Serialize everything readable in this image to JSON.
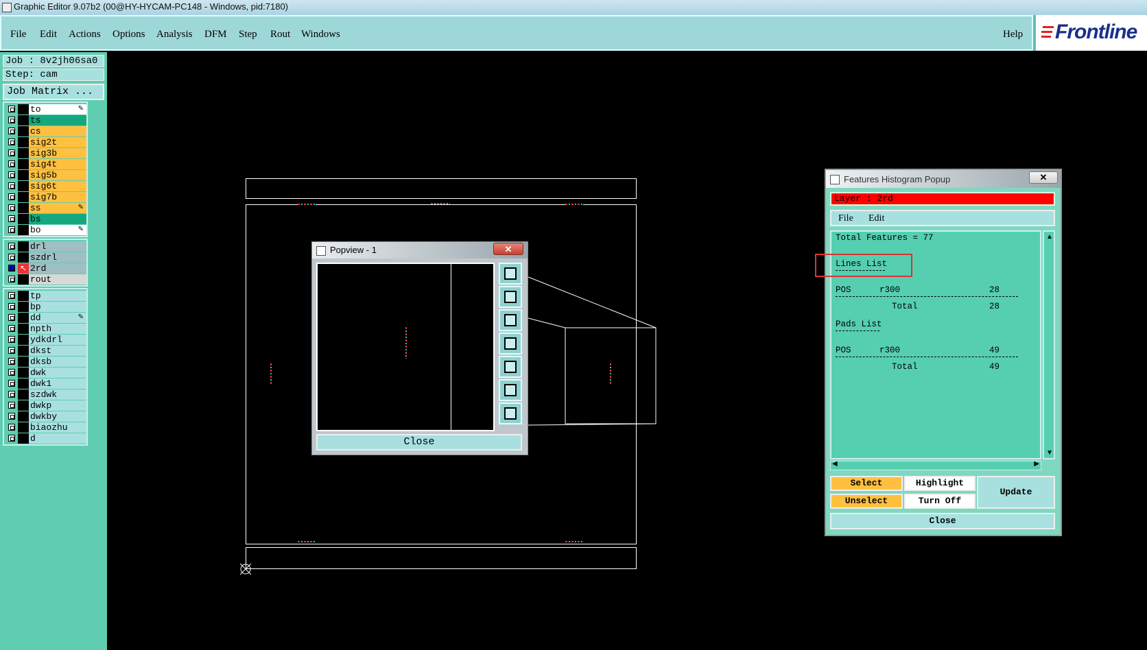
{
  "window": {
    "title": "Graphic Editor 9.07b2 (00@HY-HYCAM-PC148 - Windows, pid:7180)"
  },
  "menu": [
    "File",
    "Edit",
    "Actions",
    "Options",
    "Analysis",
    "DFM",
    "Step",
    "Rout",
    "Windows"
  ],
  "help": "Help",
  "logo": "Frontline",
  "job": {
    "job_label": "Job : 8v2jh06sa0",
    "step_label": "Step: cam",
    "matrix_button": "Job Matrix ..."
  },
  "layers": {
    "group1": [
      {
        "name": "to",
        "color": "#ffffff",
        "edit": true
      },
      {
        "name": "ts",
        "color": "#14a87e"
      },
      {
        "name": "cs",
        "color": "#ffc040"
      },
      {
        "name": "sig2t",
        "color": "#ffc040"
      },
      {
        "name": "sig3b",
        "color": "#ffc040"
      },
      {
        "name": "sig4t",
        "color": "#ffc040"
      },
      {
        "name": "sig5b",
        "color": "#ffc040"
      },
      {
        "name": "sig6t",
        "color": "#ffc040"
      },
      {
        "name": "sig7b",
        "color": "#ffc040"
      },
      {
        "name": "ss",
        "color": "#ffc040",
        "edit": true
      },
      {
        "name": "bs",
        "color": "#14a87e"
      },
      {
        "name": "bo",
        "color": "#ffffff",
        "edit": true
      }
    ],
    "group2": [
      {
        "name": "drl",
        "color": "#9fbfc4"
      },
      {
        "name": "szdrl",
        "color": "#9fbfc4"
      },
      {
        "name": "2rd",
        "color": "#9fbfc4",
        "active": true
      },
      {
        "name": "rout",
        "color": "#d8d8d8"
      }
    ],
    "group3": [
      {
        "name": "tp",
        "color": "#a8e0e0"
      },
      {
        "name": "bp",
        "color": "#a8e0e0"
      },
      {
        "name": "dd",
        "color": "#a8e0e0",
        "edit": true
      },
      {
        "name": "npth",
        "color": "#a8e0e0"
      },
      {
        "name": "ydkdrl",
        "color": "#a8e0e0"
      },
      {
        "name": "dkst",
        "color": "#a8e0e0"
      },
      {
        "name": "dksb",
        "color": "#a8e0e0"
      },
      {
        "name": "dwk",
        "color": "#a8e0e0"
      },
      {
        "name": "dwk1",
        "color": "#a8e0e0"
      },
      {
        "name": "szdwk",
        "color": "#a8e0e0"
      },
      {
        "name": "dwkp",
        "color": "#a8e0e0"
      },
      {
        "name": "dwkby",
        "color": "#a8e0e0"
      },
      {
        "name": "biaozhu",
        "color": "#a8e0e0"
      },
      {
        "name": "d",
        "color": "#a8e0e0"
      }
    ]
  },
  "popview": {
    "title": "Popview - 1",
    "close": "Close",
    "x": "✕"
  },
  "histogram": {
    "title": "Features Histogram Popup",
    "x": "✕",
    "layer": "Layer :  2rd",
    "menu": [
      "File",
      "Edit"
    ],
    "total": "Total Features = 77",
    "lines_header": "Lines List",
    "lines_row": {
      "pol": "POS",
      "sym": "r300",
      "count": "28"
    },
    "lines_total": {
      "label": "Total",
      "count": "28"
    },
    "pads_header": "Pads List",
    "pads_row": {
      "pol": "POS",
      "sym": "r300",
      "count": "49"
    },
    "pads_total": {
      "label": "Total",
      "count": "49"
    },
    "buttons": {
      "select": "Select",
      "highlight": "Highlight",
      "update": "Update",
      "unselect": "Unselect",
      "turnoff": "Turn Off",
      "close": "Close"
    }
  }
}
